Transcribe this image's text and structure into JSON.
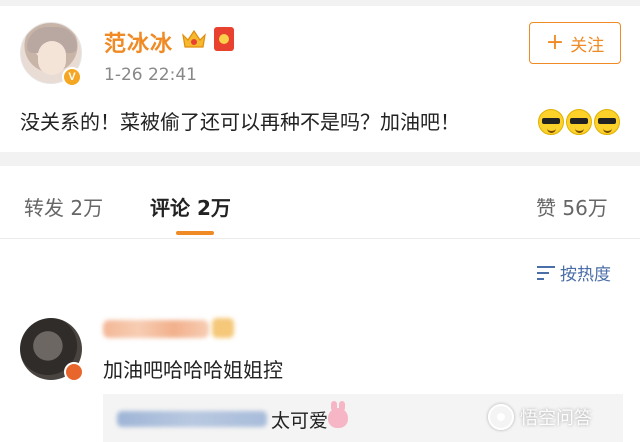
{
  "post": {
    "username": "范冰冰",
    "time": "1-26 22:41",
    "follow_label": "关注",
    "body": "没关系的！菜被偷了还可以再种不是吗？加油吧！",
    "verified_badge": "V",
    "icons": [
      "crown-icon",
      "red-packet-icon",
      "cool-sunglasses-emoji"
    ]
  },
  "tabs": [
    {
      "label": "转发 2万"
    },
    {
      "label": "评论 2万"
    },
    {
      "label": "赞 56万"
    }
  ],
  "sort": {
    "label": "按热度"
  },
  "comment": {
    "text": "加油吧哈哈哈姐姐控",
    "reply_text": "太可爱"
  },
  "watermark": {
    "text": "悟空问答"
  },
  "colors": {
    "accent": "#f08a24",
    "link": "#4a6ea8",
    "background": "#ffffff",
    "band": "#f2f2f2"
  }
}
